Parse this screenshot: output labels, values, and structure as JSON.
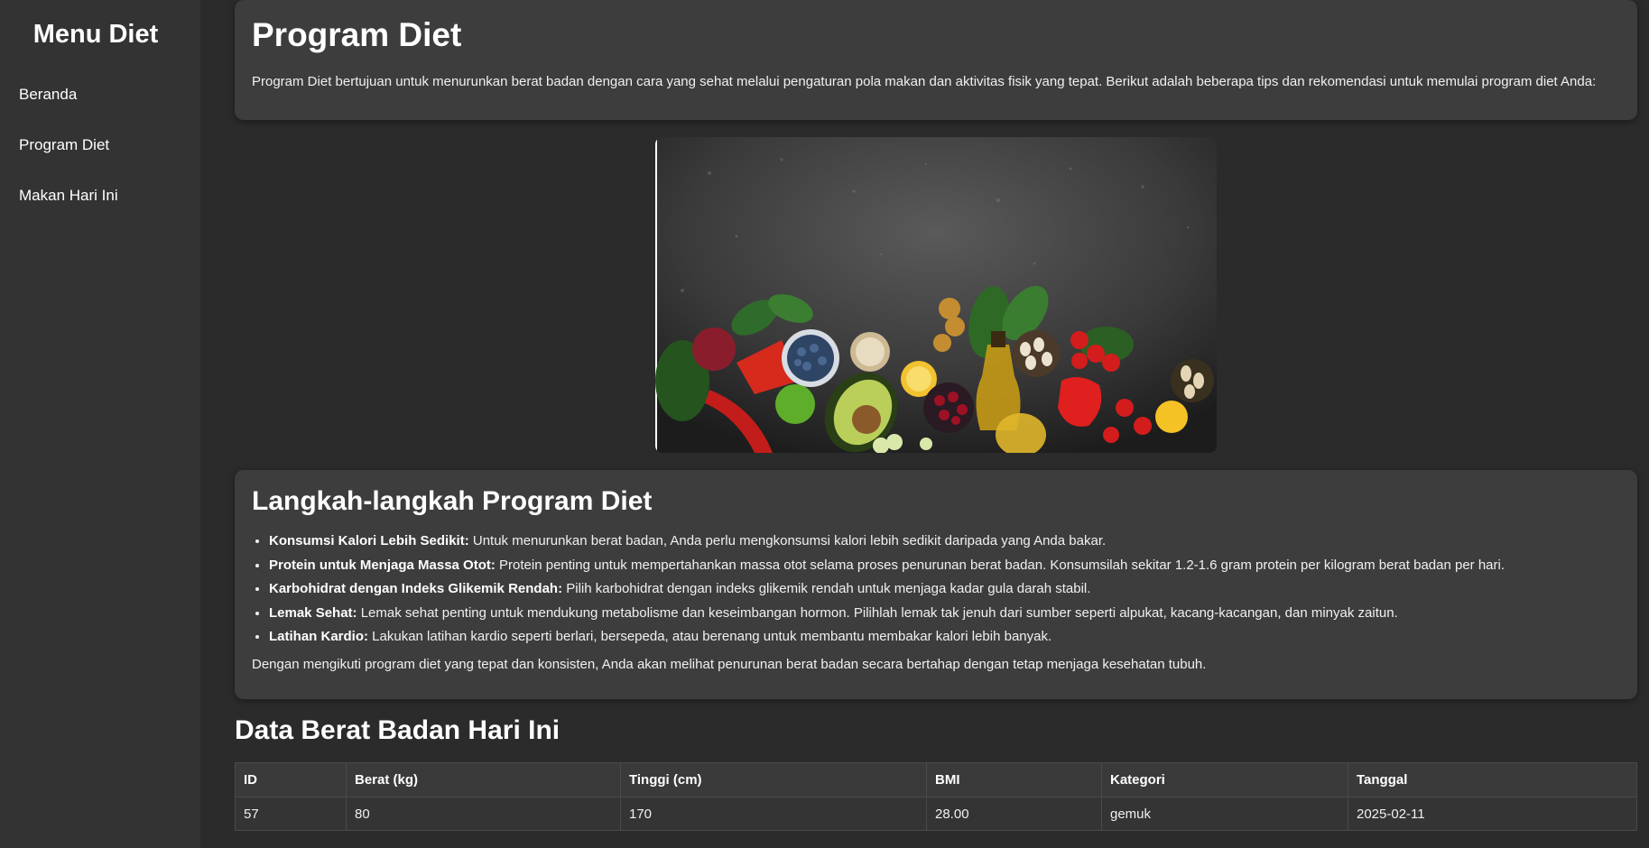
{
  "sidebar": {
    "title": "Menu Diet",
    "items": [
      {
        "label": "Beranda"
      },
      {
        "label": "Program Diet"
      },
      {
        "label": "Makan Hari Ini"
      }
    ]
  },
  "intro": {
    "title": "Program Diet",
    "text": "Program Diet bertujuan untuk menurunkan berat badan dengan cara yang sehat melalui pengaturan pola makan dan aktivitas fisik yang tepat. Berikut adalah beberapa tips dan rekomendasi untuk memulai program diet Anda:"
  },
  "steps": {
    "title": "Langkah-langkah Program Diet",
    "items": [
      {
        "label": "Konsumsi Kalori Lebih Sedikit:",
        "text": " Untuk menurunkan berat badan, Anda perlu mengkonsumsi kalori lebih sedikit daripada yang Anda bakar."
      },
      {
        "label": "Protein untuk Menjaga Massa Otot:",
        "text": " Protein penting untuk mempertahankan massa otot selama proses penurunan berat badan. Konsumsilah sekitar 1.2-1.6 gram protein per kilogram berat badan per hari."
      },
      {
        "label": "Karbohidrat dengan Indeks Glikemik Rendah:",
        "text": " Pilih karbohidrat dengan indeks glikemik rendah untuk menjaga kadar gula darah stabil."
      },
      {
        "label": "Lemak Sehat:",
        "text": " Lemak sehat penting untuk mendukung metabolisme dan keseimbangan hormon. Pilihlah lemak tak jenuh dari sumber seperti alpukat, kacang-kacangan, dan minyak zaitun."
      },
      {
        "label": "Latihan Kardio:",
        "text": " Lakukan latihan kardio seperti berlari, bersepeda, atau berenang untuk membantu membakar kalori lebih banyak."
      }
    ],
    "closing": "Dengan mengikuti program diet yang tepat dan konsisten, Anda akan melihat penurunan berat badan secara bertahap dengan tetap menjaga kesehatan tubuh."
  },
  "weight": {
    "title": "Data Berat Badan Hari Ini",
    "headers": [
      "ID",
      "Berat (kg)",
      "Tinggi (cm)",
      "BMI",
      "Kategori",
      "Tanggal"
    ],
    "rows": [
      [
        "57",
        "80",
        "170",
        "28.00",
        "gemuk",
        "2025-02-11"
      ]
    ]
  },
  "colors": {
    "background": "#2b2b2b",
    "sidebar": "#333333",
    "card": "#3d3d3d"
  }
}
